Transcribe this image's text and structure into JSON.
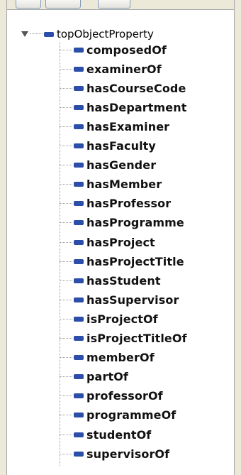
{
  "tree": {
    "root": {
      "label": "topObjectProperty",
      "expanded": true,
      "icon": "object-property-icon"
    },
    "children": [
      "composedOf",
      "examinerOf",
      "hasCourseCode",
      "hasDepartment",
      "hasExaminer",
      "hasFaculty",
      "hasGender",
      "hasMember",
      "hasProfessor",
      "hasProgramme",
      "hasProject",
      "hasProjectTitle",
      "hasStudent",
      "hasSupervisor",
      "isProjectOf",
      "isProjectTitleOf",
      "memberOf",
      "partOf",
      "professorOf",
      "programmeOf",
      "studentOf",
      "supervisorOf"
    ]
  },
  "colors": {
    "icon": "#2b4ea8",
    "connector": "#9a9a9a",
    "chrome": "#ece9d8"
  }
}
